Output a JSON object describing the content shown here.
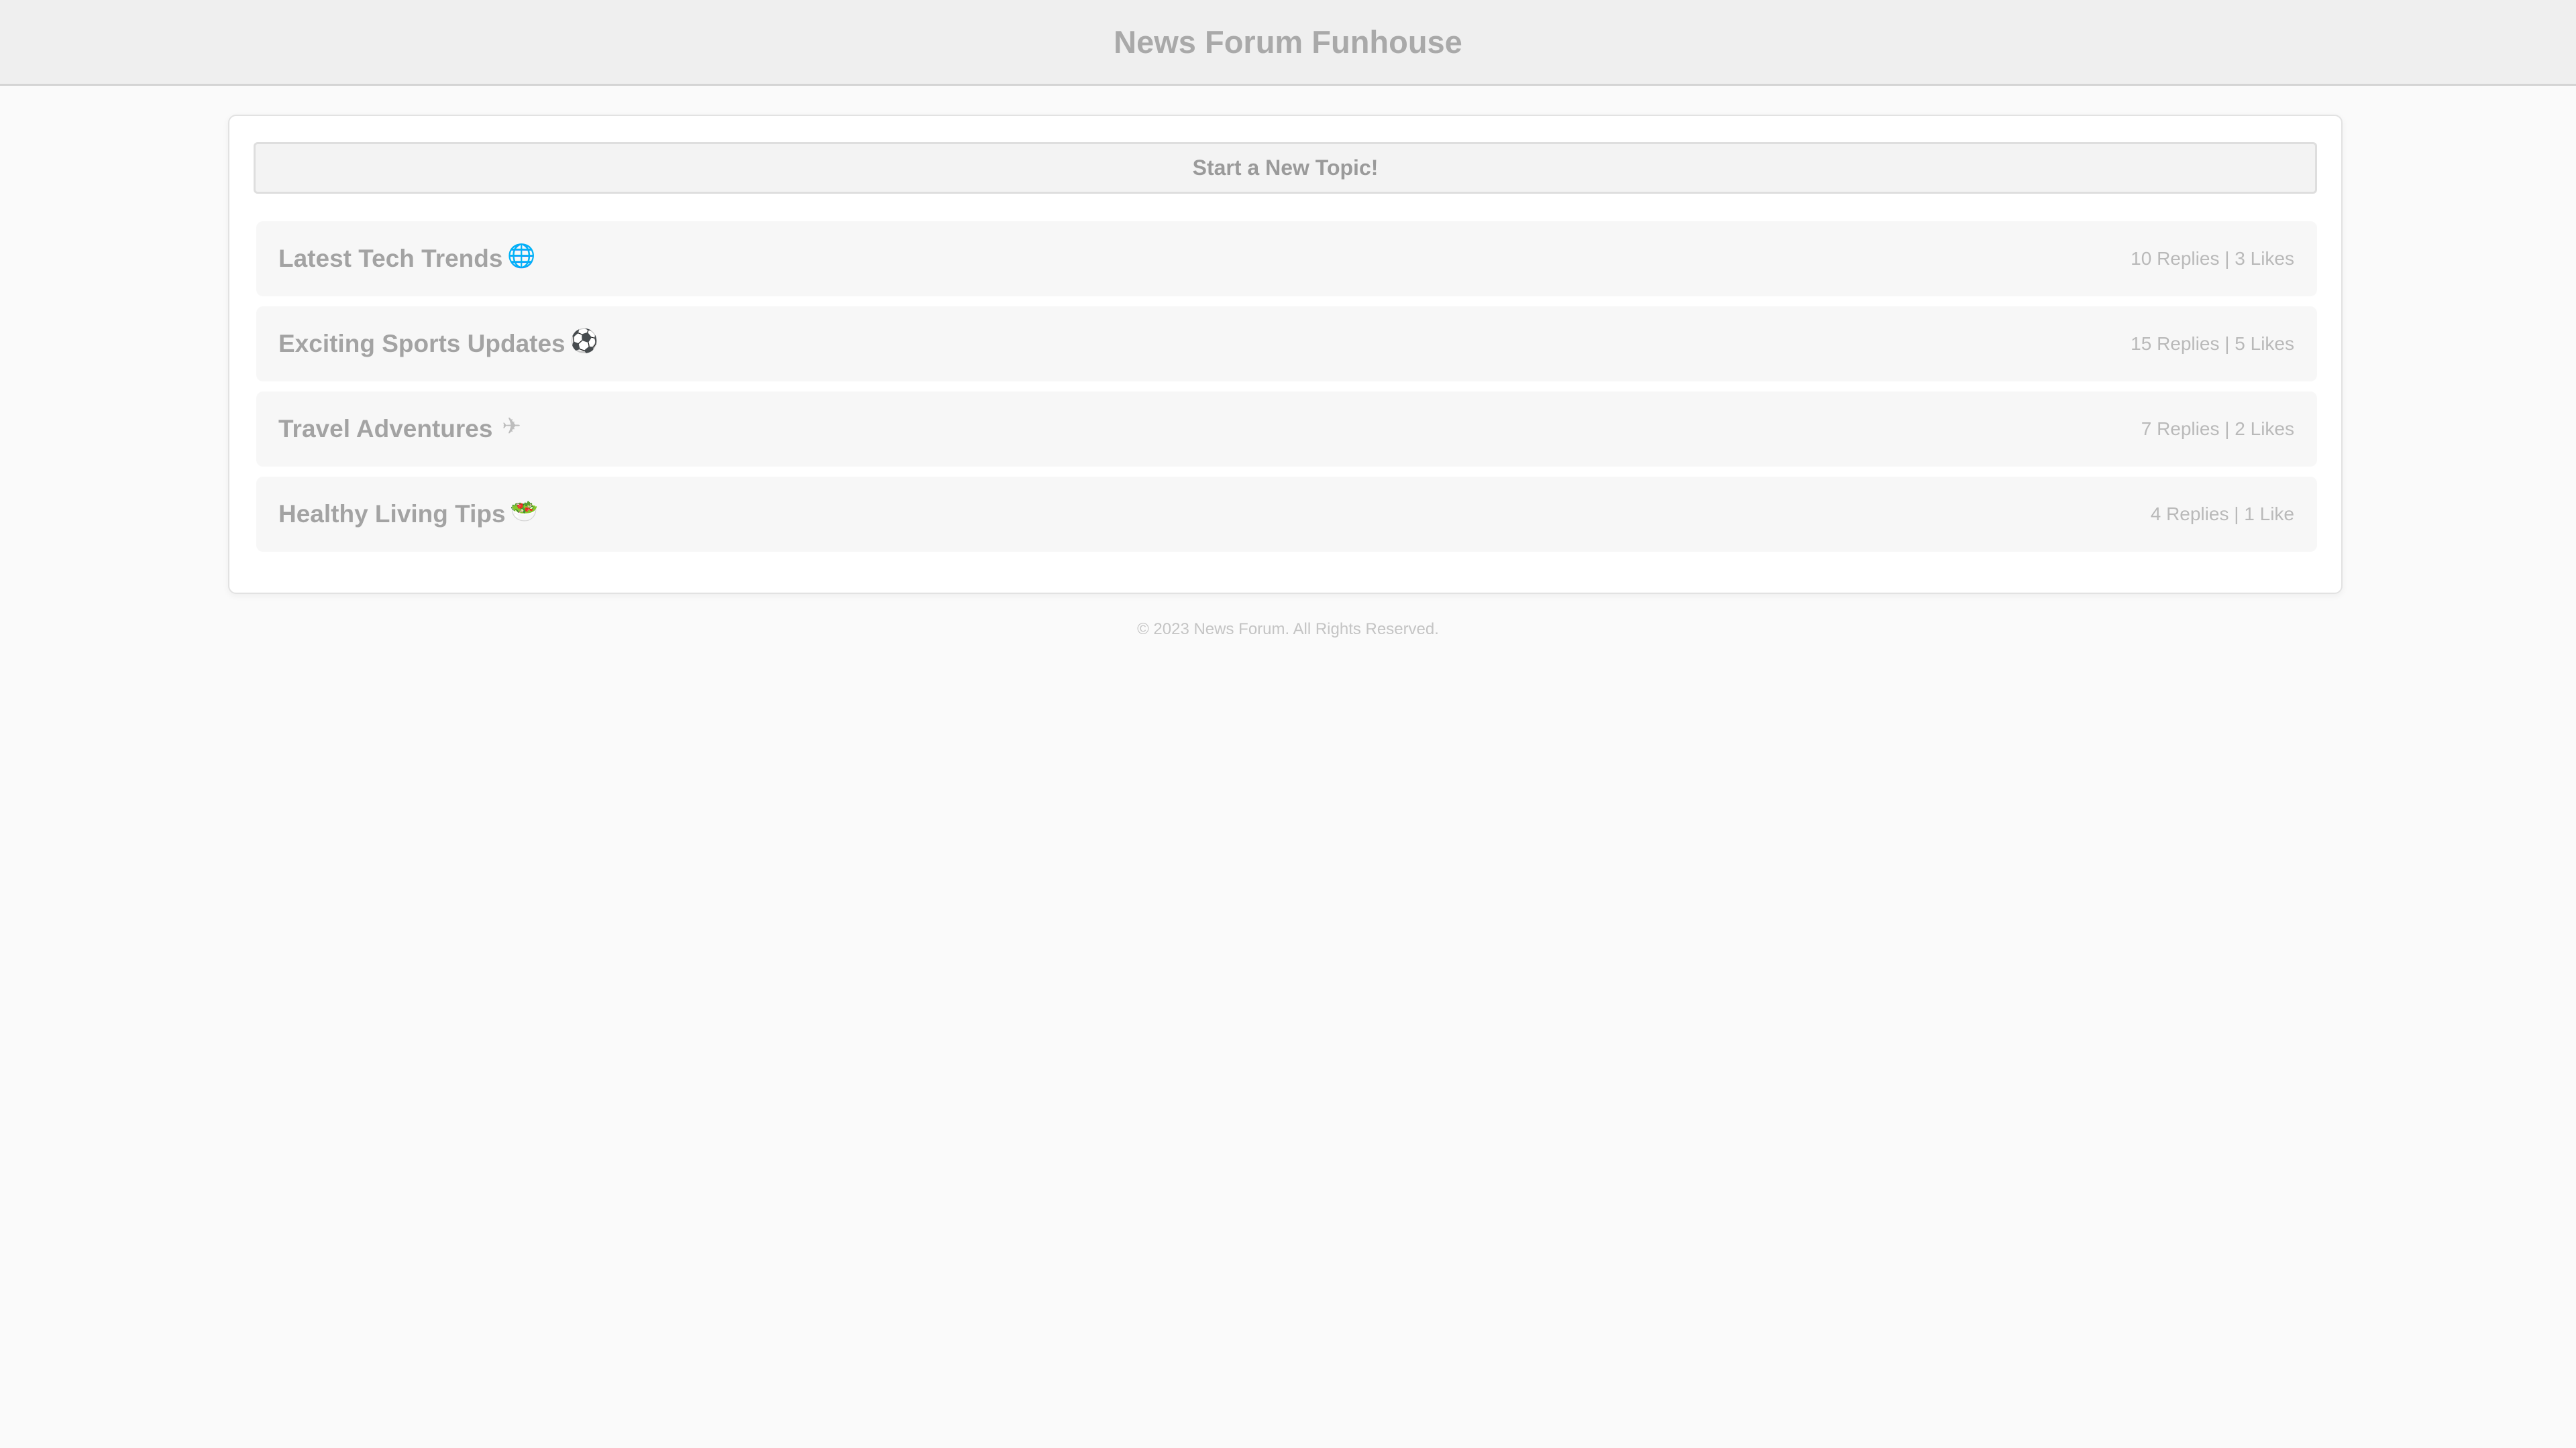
{
  "header": {
    "title": "News Forum Funhouse"
  },
  "actions": {
    "new_topic_label": "Start a New Topic!"
  },
  "topics": [
    {
      "title": "Latest Tech Trends",
      "icon": "globe-icon",
      "glyph": "🌐",
      "meta": "10 Replies | 3 Likes"
    },
    {
      "title": "Exciting Sports Updates",
      "icon": "soccer-ball-icon",
      "glyph": "⚽",
      "meta": "15 Replies | 5 Likes"
    },
    {
      "title": "Travel Adventures",
      "icon": "airplane-icon",
      "glyph": "✈",
      "meta": "7 Replies | 2 Likes"
    },
    {
      "title": "Healthy Living Tips",
      "icon": "salad-icon",
      "glyph": "🥗",
      "meta": "4 Replies | 1 Like"
    }
  ],
  "footer": {
    "copyright": "© 2023 News Forum. All Rights Reserved."
  },
  "colors": {
    "background": "#fafafa",
    "header_bg": "#efefef",
    "card_bg": "#ffffff",
    "topic_bg": "#f7f7f7"
  }
}
